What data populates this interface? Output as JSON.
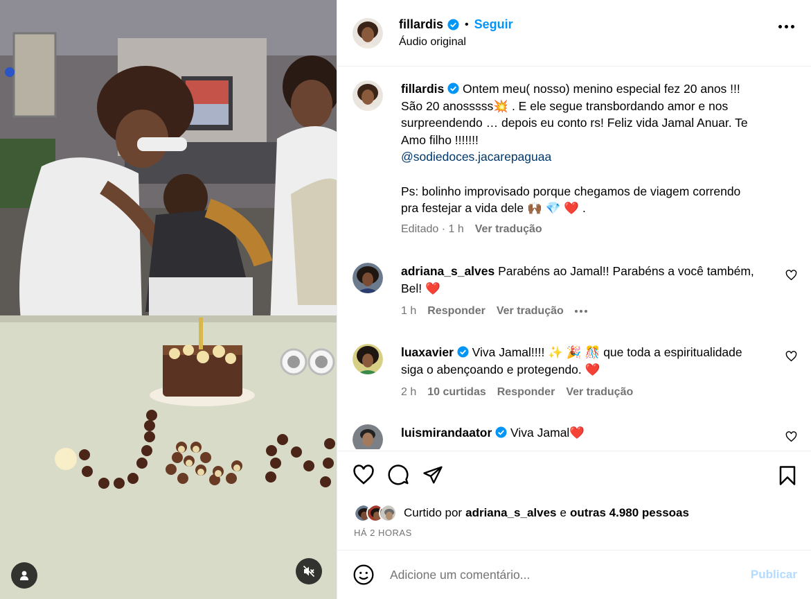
{
  "post": {
    "author": "fillardis",
    "follow_label": "Seguir",
    "separator": "•",
    "audio": "Áudio original"
  },
  "caption": {
    "author": "fillardis",
    "text_line1": "Ontem meu( nosso) menino especial fez 20 anos !!!",
    "text_line2a": "São 20 anosssss",
    "text_line2b": ". E ele segue transbordando amor e nos",
    "text_line3": "surpreendendo … depois eu conto rs! Feliz vida Jamal Anuar. Te",
    "text_line4": "Amo filho !!!!!!!",
    "mention": "@sodiedoces.jacarepaguaa",
    "ps_line1": "Ps: bolinho improvisado porque chegamos de viagem correndo",
    "ps_line2": "pra festejar a vida dele",
    "ps_end": ".",
    "edited": "Editado · 1 h",
    "translate": "Ver tradução",
    "emoji_burst": "💥",
    "emoji_hands": "🙌🏾",
    "emoji_gem": "💎",
    "emoji_heart": "❤️"
  },
  "comments": [
    {
      "user": "adriana_s_alves",
      "text_line1": "Parabéns ao Jamal!! Parabéns a você também,",
      "text_line2": "Bel!",
      "emoji": "❤️",
      "time": "1 h",
      "reply": "Responder",
      "translate": "Ver tradução"
    },
    {
      "user": "luaxavier",
      "text_a": "Viva Jamal!!!!",
      "emojis": "✨ 🎉 🎊",
      "text_b": "que toda a espiritualidade",
      "text_line2": "siga o abençoando e protegendo.",
      "emoji": "❤️",
      "time": "2 h",
      "likes": "10 curtidas",
      "reply": "Responder",
      "translate": "Ver tradução"
    },
    {
      "user": "luismirandaator",
      "text": "Viva Jamal",
      "emoji": "❤️"
    }
  ],
  "likes": {
    "prefix": "Curtido por",
    "user": "adriana_s_alves",
    "conj": "e",
    "others": "outras 4.980 pessoas"
  },
  "time_ago": "HÁ 2 HORAS",
  "add_comment": {
    "placeholder": "Adicione um comentário...",
    "post_label": "Publicar"
  },
  "icons": {
    "verified": "verified-badge-icon",
    "more": "more-options-icon",
    "like": "heart-icon",
    "comment": "comment-icon",
    "share": "share-icon",
    "save": "bookmark-icon",
    "emoji": "emoji-icon",
    "user": "user-icon",
    "mute": "muted-speaker-icon"
  },
  "colors": {
    "accent": "#0095f6",
    "muted_text": "#737373",
    "mention": "#00376b",
    "heart": "#ed4956",
    "post_disabled": "#b3dbff"
  }
}
